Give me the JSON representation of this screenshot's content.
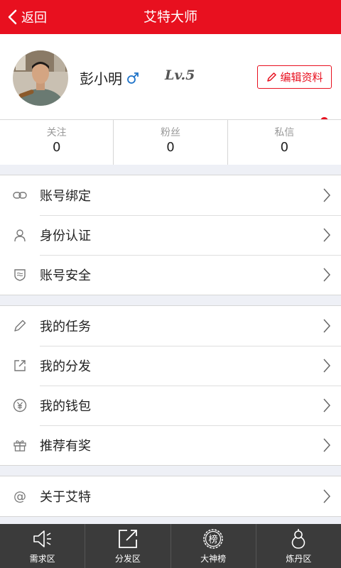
{
  "header": {
    "back_label": "返回",
    "title": "艾特大师"
  },
  "profile": {
    "username": "彭小明",
    "level": "Lv.5",
    "edit_label": "编辑资料"
  },
  "stats": [
    {
      "label": "关注",
      "count": "0"
    },
    {
      "label": "粉丝",
      "count": "0"
    },
    {
      "label": "私信",
      "count": "0"
    }
  ],
  "menu": {
    "group1": [
      {
        "label": "账号绑定",
        "icon": "link-icon"
      },
      {
        "label": "身份认证",
        "icon": "user-icon"
      },
      {
        "label": "账号安全",
        "icon": "shield-icon"
      }
    ],
    "group2": [
      {
        "label": "我的任务",
        "icon": "pencil-icon"
      },
      {
        "label": "我的分发",
        "icon": "share-icon"
      },
      {
        "label": "我的钱包",
        "icon": "yuan-icon"
      },
      {
        "label": "推荐有奖",
        "icon": "gift-icon"
      }
    ],
    "group3": [
      {
        "label": "关于艾特",
        "icon": "at-icon"
      }
    ]
  },
  "tabs": [
    {
      "label": "需求区",
      "icon": "megaphone-icon"
    },
    {
      "label": "分发区",
      "icon": "share-icon"
    },
    {
      "label": "大神榜",
      "icon": "ranking-badge-icon",
      "badge_text": "榜"
    },
    {
      "label": "炼丹区",
      "icon": "gourd-icon"
    }
  ],
  "colors": {
    "accent": "#e8101f",
    "tabbar": "#3b3b3b",
    "background": "#eef0f6"
  }
}
